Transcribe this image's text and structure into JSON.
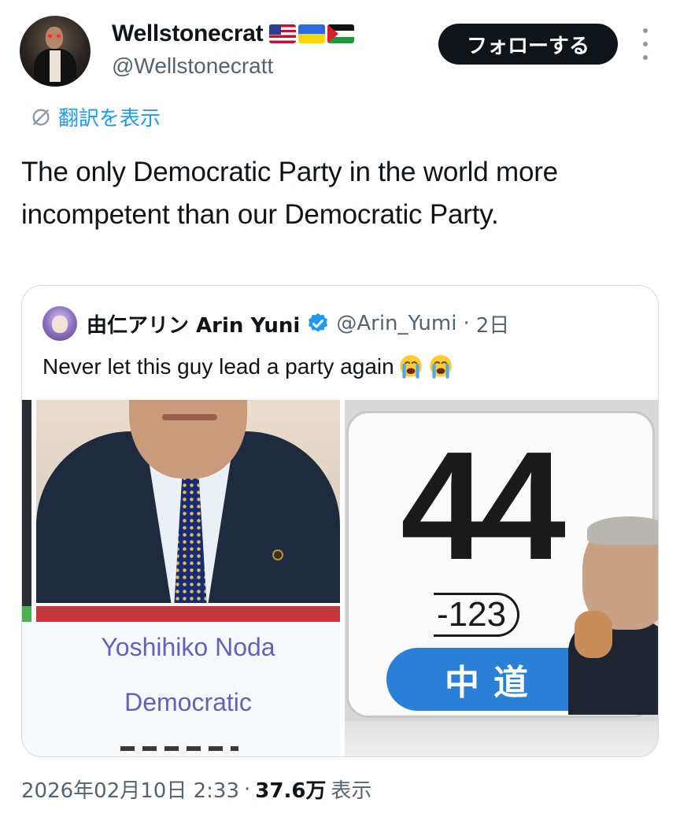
{
  "author": {
    "display_name": "Wellstonecrat",
    "handle": "@Wellstonecratt",
    "flags": [
      "us-flag",
      "ukraine-flag",
      "palestine-flag"
    ]
  },
  "header": {
    "follow_label": "フォローする"
  },
  "translate": {
    "label": "翻訳を表示"
  },
  "tweet": {
    "text": "The only Democratic Party in the world more incompetent than our Democratic Party."
  },
  "quoted": {
    "display_name": "由仁アリン Arin Yuni",
    "handle": "@Arin_Yumi",
    "separator": "·",
    "time": "2日",
    "text": "Never let this guy lead a party again",
    "emoji": [
      "loudly-crying-face",
      "loudly-crying-face"
    ],
    "media": {
      "left": {
        "name": "Yoshihiko Noda",
        "party": "Democratic"
      },
      "right": {
        "seats": "44",
        "change": "-123",
        "party": "中道"
      }
    }
  },
  "meta": {
    "timestamp": "2026年02月10日 2:33",
    "separator": "·",
    "views_count": "37.6万",
    "views_label": "表示"
  },
  "colors": {
    "accent": "#1d9bf0",
    "muted": "#536471",
    "follow_bg": "#0f1419",
    "wiki_link": "#6a5fb8",
    "party_blue": "#2a7fd6",
    "party_red": "#c6373b"
  }
}
